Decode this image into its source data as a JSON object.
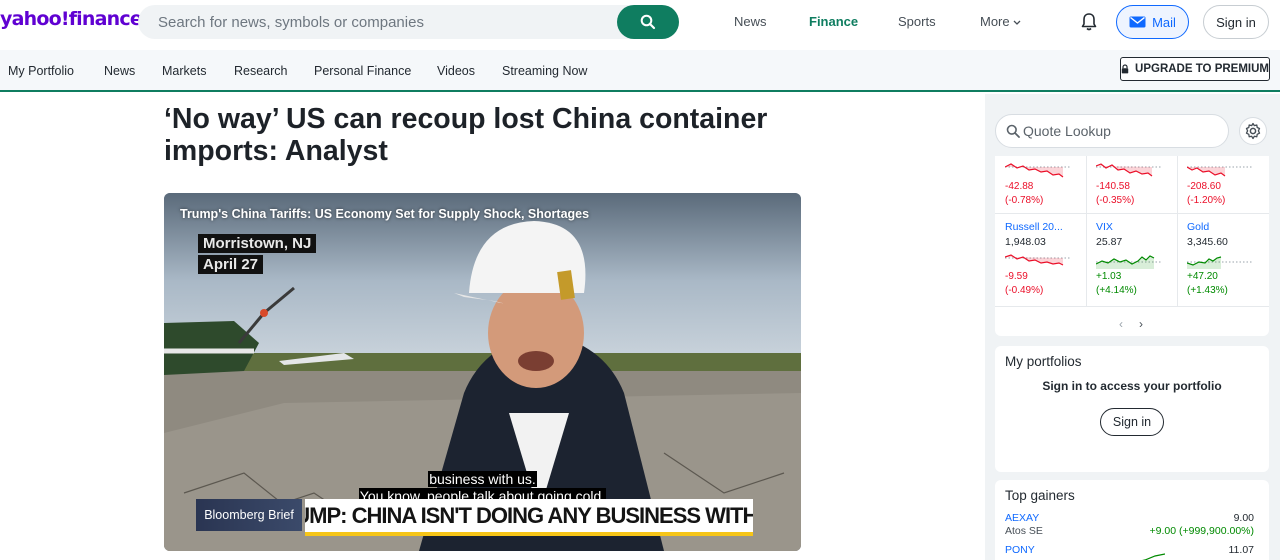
{
  "header": {
    "logo": "yahoo!finance",
    "search_placeholder": "Search for news, symbols or companies",
    "nav": [
      "News",
      "Finance",
      "Sports",
      "More"
    ],
    "mail_label": "Mail",
    "signin_label": "Sign in"
  },
  "subnav": {
    "items": [
      "My Portfolio",
      "News",
      "Markets",
      "Research",
      "Personal Finance",
      "Videos",
      "Streaming Now"
    ],
    "upgrade_label": "UPGRADE TO PREMIUM"
  },
  "article": {
    "headline": "‘No way’ US can recoup lost China container imports: Analyst",
    "video": {
      "title": "Trump's China Tariffs: US Economy Set for Supply Shock, Shortages",
      "location": "Morristown, NJ",
      "date": "April 27",
      "caption_line1": "business with us.",
      "caption_line2": "You know, people talk about going cold,",
      "brand_label": "Bloomberg Brief",
      "chyron": "TRUMP: CHINA ISN'T DOING ANY BUSINESS WITH US"
    }
  },
  "rail": {
    "quote_placeholder": "Quote Lookup",
    "tickers_row1": [
      {
        "change": "-42.88",
        "pct": "(-0.78%)",
        "dir": "down"
      },
      {
        "change": "-140.58",
        "pct": "(-0.35%)",
        "dir": "down"
      },
      {
        "change": "-208.60",
        "pct": "(-1.20%)",
        "dir": "down"
      }
    ],
    "tickers_row2": [
      {
        "name": "Russell 20...",
        "price": "1,948.03",
        "change": "-9.59",
        "pct": "(-0.49%)",
        "dir": "down"
      },
      {
        "name": "VIX",
        "price": "25.87",
        "change": "+1.03",
        "pct": "(+4.14%)",
        "dir": "up"
      },
      {
        "name": "Gold",
        "price": "3,345.60",
        "change": "+47.20",
        "pct": "(+1.43%)",
        "dir": "up"
      }
    ],
    "pager_prev": "‹",
    "pager_next": "›",
    "portfolios": {
      "title": "My portfolios",
      "subtitle": "Sign in to access your portfolio",
      "button": "Sign in"
    },
    "gainers": {
      "title": "Top gainers",
      "rows": [
        {
          "symbol": "AEXAY",
          "company": "Atos SE",
          "price": "9.00",
          "change": "+9.00 (+999,900.00%)"
        },
        {
          "symbol": "PONY",
          "company": "",
          "price": "11.07",
          "change": ""
        }
      ]
    }
  },
  "colors": {
    "brand": "#6001d2",
    "accent": "#0f7d60",
    "link": "#0f69ff",
    "negative": "#eb0f29",
    "positive": "#008a00"
  }
}
